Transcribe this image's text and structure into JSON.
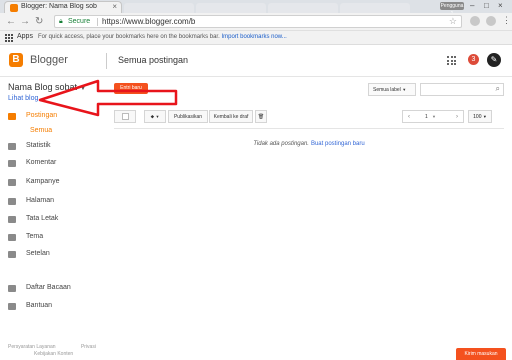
{
  "browser": {
    "tab_title": "Blogger: Nama Blog sob",
    "tab_close": "×",
    "user_badge": "Pengguna 1",
    "window_buttons": {
      "minimize": "–",
      "maximize": "□",
      "close": "×"
    },
    "nav": {
      "back": "←",
      "forward": "→",
      "reload": "↻"
    },
    "secure_label": "Secure",
    "url": "https://www.blogger.com/b",
    "apps_label": "Apps",
    "bookmarks_message": "For quick access, place your bookmarks here on the bookmarks bar.",
    "bookmarks_link": "Import bookmarks now..."
  },
  "header": {
    "logo_letter": "B",
    "brand": "Blogger",
    "page_title": "Semua postingan",
    "notification_count": "3",
    "avatar_letter": "✎"
  },
  "sidebar": {
    "blog_title": "Nama Blog sobat",
    "view_blog": "Lihat blog",
    "new_post_button": "Entri baru",
    "items": [
      {
        "label": "Postingan",
        "icon": "document-icon",
        "active": true
      },
      {
        "label": "Statistik",
        "icon": "stats-icon"
      },
      {
        "label": "Komentar",
        "icon": "comment-icon"
      },
      {
        "label": "Kampanye",
        "icon": "campaign-icon"
      },
      {
        "label": "Halaman",
        "icon": "pages-icon"
      },
      {
        "label": "Tata Letak",
        "icon": "layout-icon"
      },
      {
        "label": "Tema",
        "icon": "theme-icon"
      },
      {
        "label": "Setelan",
        "icon": "settings-icon"
      },
      {
        "label": "Daftar Bacaan",
        "icon": "reading-list-icon"
      },
      {
        "label": "Bantuan",
        "icon": "help-icon"
      }
    ],
    "sub_item": "Semua",
    "footer_terms": "Persyaratan Layanan",
    "footer_privacy": "Privasi",
    "footer_content_policy": "Kebijakan Konten"
  },
  "toolbar": {
    "label_select": "Semua label",
    "publish_button": "Publikasikan",
    "revert_button": "Kembali ke draf",
    "page_number": "1",
    "page_size": "100"
  },
  "main": {
    "empty_message": "Tidak ada postingan.",
    "create_link": "Buat postingan baru"
  },
  "feedback_button": "Kirim masukan",
  "colors": {
    "brand": "#f57d00",
    "accent_red": "#f4511e",
    "link": "#3367d6",
    "annotation_arrow": "#e8141b"
  }
}
